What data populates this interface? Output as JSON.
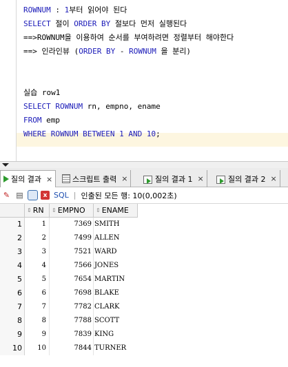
{
  "editor": {
    "lines": [
      [
        {
          "t": "ROWNUM",
          "c": "kw"
        },
        {
          "t": " : "
        },
        {
          "t": "1",
          "c": "num"
        },
        {
          "t": "부터 읽어야 된다"
        }
      ],
      [
        {
          "t": "SELECT",
          "c": "kw"
        },
        {
          "t": " 절이 "
        },
        {
          "t": "ORDER BY",
          "c": "kw"
        },
        {
          "t": " 절보다 먼저 실행된다"
        }
      ],
      [
        {
          "t": "==>ROWNUM을 이용하여 순서를 부여하려면 정렬부터 해야한다"
        }
      ],
      [
        {
          "t": "==> 인라인뷰 ("
        },
        {
          "t": "ORDER BY",
          "c": "kw"
        },
        {
          "t": " - "
        },
        {
          "t": "ROWNUM",
          "c": "kw"
        },
        {
          "t": " 을 분리)"
        }
      ],
      [],
      [],
      [
        {
          "t": "실습 row1"
        }
      ],
      [
        {
          "t": "SELECT",
          "c": "kw"
        },
        {
          "t": " "
        },
        {
          "t": "ROWNUM",
          "c": "kw"
        },
        {
          "t": " rn, empno, ename"
        }
      ],
      [
        {
          "t": "FROM",
          "c": "kw"
        },
        {
          "t": " emp"
        }
      ],
      [
        {
          "t": "WHERE",
          "c": "kw"
        },
        {
          "t": " "
        },
        {
          "t": "ROWNUM",
          "c": "kw"
        },
        {
          "t": " "
        },
        {
          "t": "BETWEEN",
          "c": "kw"
        },
        {
          "t": " "
        },
        {
          "t": "1",
          "c": "num"
        },
        {
          "t": " "
        },
        {
          "t": "AND",
          "c": "kw"
        },
        {
          "t": " "
        },
        {
          "t": "10",
          "c": "num"
        },
        {
          "t": ";"
        }
      ]
    ]
  },
  "tabs": [
    {
      "label": "질의 결과",
      "close": "×",
      "icon": "play-icon",
      "active": true
    },
    {
      "label": "스크립트 출력",
      "close": "×",
      "icon": "script-icon",
      "active": false
    },
    {
      "label": "질의 결과 1",
      "close": "×",
      "icon": "query-grid-icon",
      "active": false
    },
    {
      "label": "질의 결과 2",
      "close": "×",
      "icon": "query-grid-icon",
      "active": false
    }
  ],
  "toolbar": {
    "sql_label": "SQL",
    "separator": "|",
    "fetch_status": "인출된 모든 행: 10(0,002초)"
  },
  "grid": {
    "columns": [
      "RN",
      "EMPNO",
      "ENAME"
    ],
    "rows": [
      {
        "num": "1",
        "rn": "1",
        "empno": "7369",
        "ename": "SMITH"
      },
      {
        "num": "2",
        "rn": "2",
        "empno": "7499",
        "ename": "ALLEN"
      },
      {
        "num": "3",
        "rn": "3",
        "empno": "7521",
        "ename": "WARD"
      },
      {
        "num": "4",
        "rn": "4",
        "empno": "7566",
        "ename": "JONES"
      },
      {
        "num": "5",
        "rn": "5",
        "empno": "7654",
        "ename": "MARTIN"
      },
      {
        "num": "6",
        "rn": "6",
        "empno": "7698",
        "ename": "BLAKE"
      },
      {
        "num": "7",
        "rn": "7",
        "empno": "7782",
        "ename": "CLARK"
      },
      {
        "num": "8",
        "rn": "8",
        "empno": "7788",
        "ename": "SCOTT"
      },
      {
        "num": "9",
        "rn": "9",
        "empno": "7839",
        "ename": "KING"
      },
      {
        "num": "10",
        "rn": "10",
        "empno": "7844",
        "ename": "TURNER"
      }
    ]
  },
  "colors": {
    "keyword": "#1a1ab8",
    "current_line": "#fdf6e0",
    "run_icon": "#2e9b2e"
  }
}
